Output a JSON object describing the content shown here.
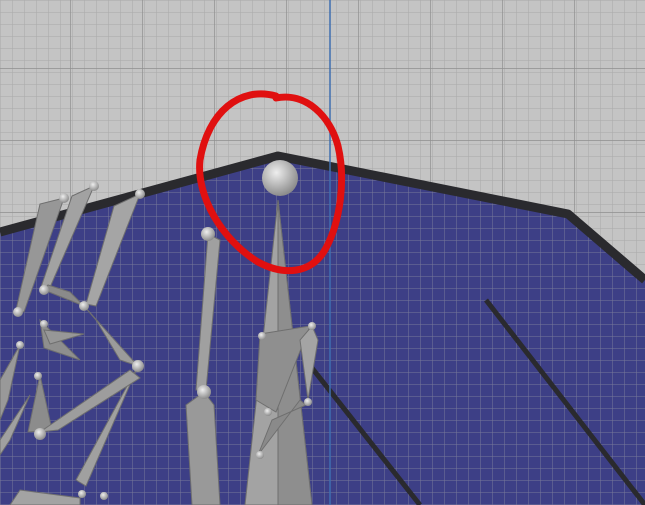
{
  "viewport": {
    "view": "3d-viewport",
    "grid_visible": true,
    "annotation": "red-circle-highlight"
  },
  "colors": {
    "background": "#c4c4c4",
    "grid_minor": "#a9a9a9",
    "grid_major": "#8f8f8f",
    "mesh_fill": "#3d3f86",
    "mesh_edge": "#2a2a2e",
    "axis_line": "#3f6fb0",
    "bone": "#9a9a9a",
    "bone_dark": "#6f6f6f",
    "joint": "#bdbdbd",
    "annotation": "#e01010"
  },
  "icons": [
    "bone-joint-icon",
    "bone-icon"
  ]
}
